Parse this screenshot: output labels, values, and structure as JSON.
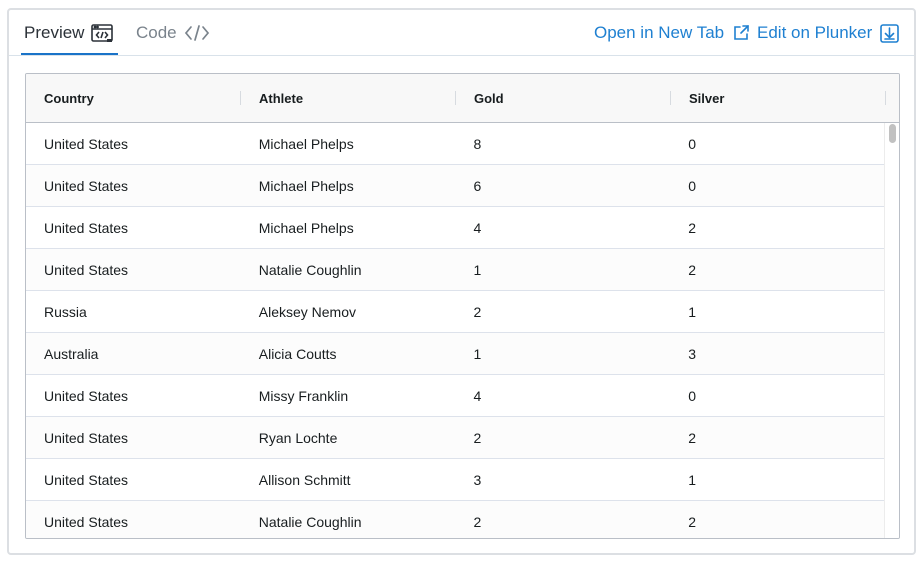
{
  "tabs": {
    "preview_label": "Preview",
    "code_label": "Code"
  },
  "actions": {
    "open_new_tab": "Open in New Tab",
    "edit_plunker": "Edit on Plunker"
  },
  "grid": {
    "columns": [
      "Country",
      "Athlete",
      "Gold",
      "Silver"
    ],
    "rows": [
      [
        "United States",
        "Michael Phelps",
        "8",
        "0"
      ],
      [
        "United States",
        "Michael Phelps",
        "6",
        "0"
      ],
      [
        "United States",
        "Michael Phelps",
        "4",
        "2"
      ],
      [
        "United States",
        "Natalie Coughlin",
        "1",
        "2"
      ],
      [
        "Russia",
        "Aleksey Nemov",
        "2",
        "1"
      ],
      [
        "Australia",
        "Alicia Coutts",
        "1",
        "3"
      ],
      [
        "United States",
        "Missy Franklin",
        "4",
        "0"
      ],
      [
        "United States",
        "Ryan Lochte",
        "2",
        "2"
      ],
      [
        "United States",
        "Allison Schmitt",
        "3",
        "1"
      ],
      [
        "United States",
        "Natalie Coughlin",
        "2",
        "2"
      ]
    ]
  },
  "colors": {
    "accent": "#1a73c8",
    "link": "#1f80d1",
    "border": "#babfc7",
    "header_bg": "#f8f8f8"
  },
  "icons": {
    "preview": "browser-code-icon",
    "code": "code-brackets-icon",
    "new_tab": "external-link-icon",
    "plunker": "download-box-icon"
  }
}
